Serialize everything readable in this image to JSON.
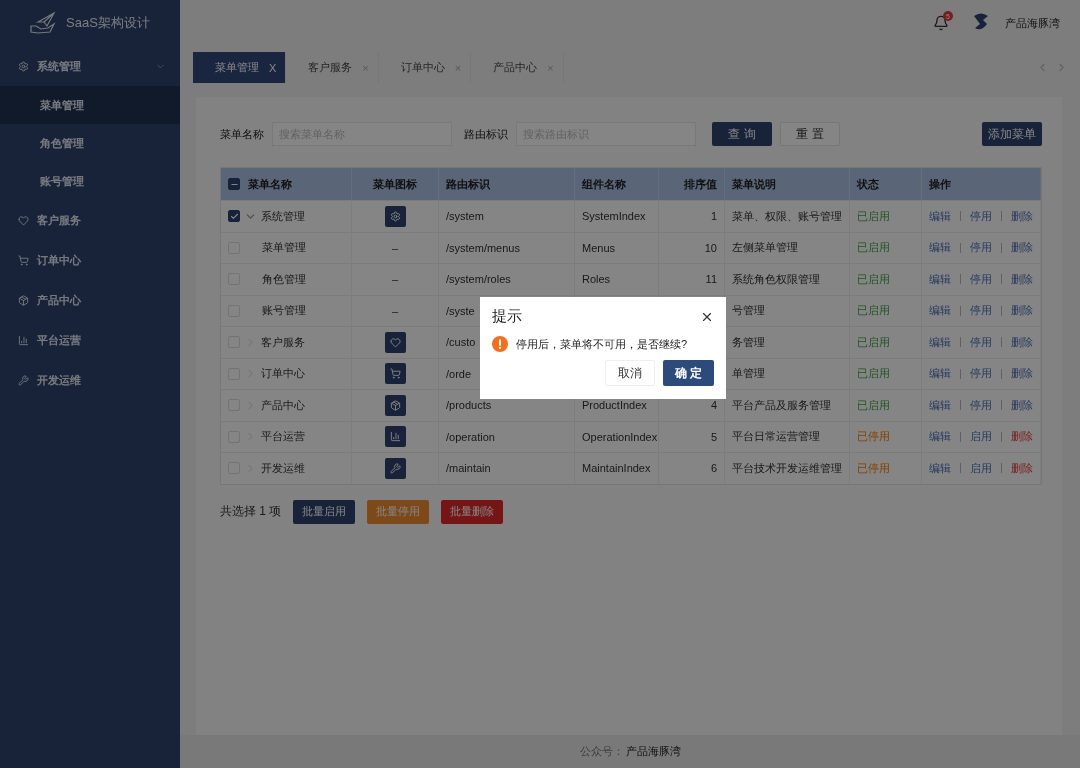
{
  "app": {
    "title": "SaaS架构设计"
  },
  "sidebar": {
    "items": [
      {
        "label": "系统管理",
        "expanded": true,
        "children": [
          {
            "label": "菜单管理",
            "selected": true
          },
          {
            "label": "角色管理",
            "selected": false
          },
          {
            "label": "账号管理",
            "selected": false
          }
        ]
      },
      {
        "label": "客户服务"
      },
      {
        "label": "订单中心"
      },
      {
        "label": "产品中心"
      },
      {
        "label": "平台运营"
      },
      {
        "label": "开发运维"
      }
    ]
  },
  "header": {
    "notification_badge": "5",
    "user_name": "产品海豚湾"
  },
  "tabs": [
    {
      "label": "菜单管理",
      "close": "X",
      "selected": true
    },
    {
      "label": "客户服务",
      "close": "×",
      "selected": false
    },
    {
      "label": "订单中心",
      "close": "×",
      "selected": false
    },
    {
      "label": "产品中心",
      "close": "×",
      "selected": false
    }
  ],
  "filters": [
    {
      "label": "菜单名称",
      "placeholder": "搜索菜单名称"
    },
    {
      "label": "路由标识",
      "placeholder": "搜索路由标识"
    }
  ],
  "filter_buttons": [
    {
      "label": "查 询",
      "kind": "primary"
    },
    {
      "label": "重 置",
      "kind": "plain"
    }
  ],
  "add_button": "添加菜单",
  "table": {
    "columns": [
      "菜单名称",
      "菜单图标",
      "路由标识",
      "组件名称",
      "排序值",
      "菜单说明",
      "状态",
      "操作"
    ],
    "header_indeterminate": true,
    "rows": [
      {
        "name": "系统管理",
        "checked": true,
        "expanded": true,
        "route": "/system",
        "component": "SystemIndex",
        "sort": "1",
        "desc": "菜单、权限、账号管理",
        "status": "已启用",
        "enabled": true,
        "actions": [
          "编辑",
          "停用",
          "删除"
        ],
        "children": [
          {
            "name": "菜单管理",
            "checked": false,
            "icon_text": "–",
            "route": "/system/menus",
            "component": "Menus",
            "sort": "10",
            "desc": "左侧菜单管理",
            "status": "已启用",
            "enabled": true,
            "actions": [
              "编辑",
              "停用",
              "删除"
            ]
          },
          {
            "name": "角色管理",
            "checked": false,
            "icon_text": "–",
            "route": "/system/roles",
            "component": "Roles",
            "sort": "11",
            "desc": "系统角色权限管理",
            "status": "已启用",
            "enabled": true,
            "actions": [
              "编辑",
              "停用",
              "删除"
            ]
          },
          {
            "name": "账号管理",
            "checked": false,
            "icon_text": "–",
            "route": "/syste",
            "desc": "号管理",
            "status": "已启用",
            "enabled": true,
            "actions": [
              "编辑",
              "停用",
              "删除"
            ]
          }
        ]
      },
      {
        "name": "客户服务",
        "checked": false,
        "expanded": false,
        "route": "/custo",
        "desc": "务管理",
        "status": "已启用",
        "enabled": true,
        "actions": [
          "编辑",
          "停用",
          "删除"
        ]
      },
      {
        "name": "订单中心",
        "checked": false,
        "expanded": false,
        "route": "/orde",
        "desc": "单管理",
        "status": "已启用",
        "enabled": true,
        "actions": [
          "编辑",
          "停用",
          "删除"
        ]
      },
      {
        "name": "产品中心",
        "checked": false,
        "expanded": false,
        "route": "/products",
        "component": "ProductIndex",
        "sort": "4",
        "desc": "平台产品及服务管理",
        "status": "已启用",
        "enabled": true,
        "actions": [
          "编辑",
          "停用",
          "删除"
        ]
      },
      {
        "name": "平台运营",
        "checked": false,
        "expanded": false,
        "route": "/operation",
        "component": "OperationIndex",
        "sort": "5",
        "desc": "平台日常运营管理",
        "status": "已停用",
        "enabled": false,
        "actions": [
          "编辑",
          "启用",
          "删除"
        ]
      },
      {
        "name": "开发运维",
        "checked": false,
        "expanded": false,
        "route": "/maintain",
        "component": "MaintainIndex",
        "sort": "6",
        "desc": "平台技术开发运维管理",
        "status": "已停用",
        "enabled": false,
        "actions": [
          "编辑",
          "启用",
          "删除"
        ]
      }
    ]
  },
  "selection": {
    "summary": "共选择 1 项",
    "buttons": [
      {
        "label": "批量启用",
        "kind": "enable"
      },
      {
        "label": "批量停用",
        "kind": "disable"
      },
      {
        "label": "批量删除",
        "kind": "delete"
      }
    ]
  },
  "footer": {
    "label": "公众号：",
    "value": "产品海豚湾"
  },
  "dialog": {
    "title": "提示",
    "message": "停用后，菜单将不可用，是否继续?",
    "buttons": [
      {
        "label": "取消",
        "kind": "cancel"
      },
      {
        "label": "确 定",
        "kind": "confirm"
      }
    ]
  }
}
